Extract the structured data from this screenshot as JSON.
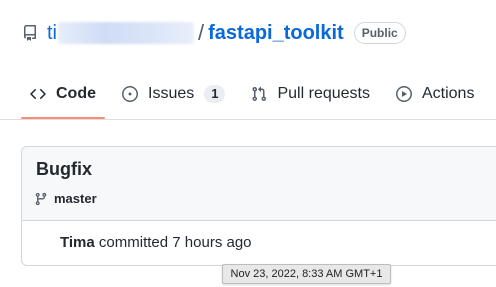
{
  "repo": {
    "owner_visible": "ti",
    "separator": "/",
    "name": "fastapi_toolkit",
    "visibility_badge": "Public",
    "icon": "repo-icon"
  },
  "tabs": [
    {
      "label": "Code",
      "icon": "code-icon",
      "selected": true
    },
    {
      "label": "Issues",
      "icon": "issue-opened-icon",
      "count": "1"
    },
    {
      "label": "Pull requests",
      "icon": "git-pull-request-icon"
    },
    {
      "label": "Actions",
      "icon": "play-icon"
    }
  ],
  "commit": {
    "title": "Bugfix",
    "branch": "master",
    "branch_icon": "git-branch-icon",
    "author": "Tima",
    "action_text": " committed ",
    "relative_time": "7 hours ago"
  },
  "tooltip": {
    "text": "Nov 23, 2022, 8:33 AM GMT+1"
  },
  "colors": {
    "link": "#0969da",
    "selected_underline": "#fd8c73",
    "text": "#24292f",
    "muted": "#57606a",
    "border": "#d0d7de"
  }
}
